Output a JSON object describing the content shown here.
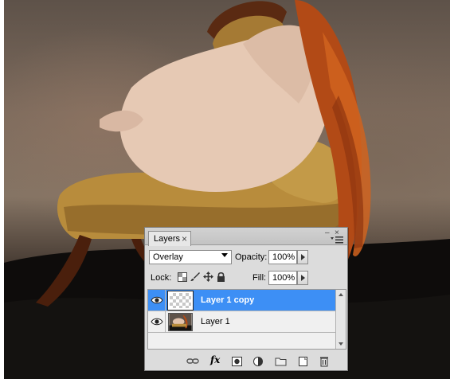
{
  "panel": {
    "tab_label": "Layers",
    "tab_close_glyph": "×",
    "blend_mode": "Overlay",
    "opacity_label": "Opacity:",
    "opacity_value": "100%",
    "lock_label": "Lock:",
    "fill_label": "Fill:",
    "fill_value": "100%",
    "bottom_fx_label": "fx",
    "layers": [
      {
        "name": "Layer 1 copy",
        "selected": true,
        "visible": true,
        "thumbnail": "transparent-checker"
      },
      {
        "name": "Layer 1",
        "selected": false,
        "visible": true,
        "thumbnail": "photo"
      }
    ],
    "icons": [
      "eye-icon",
      "lock-transparent-icon",
      "lock-brush-icon",
      "lock-move-icon",
      "lock-all-icon",
      "link-icon",
      "fx-icon",
      "mask-icon",
      "adjustment-icon",
      "group-folder-icon",
      "new-layer-icon",
      "trash-icon"
    ]
  },
  "colors": {
    "selection": "#3d8ff5",
    "panel_bg": "#dcdcdc"
  }
}
